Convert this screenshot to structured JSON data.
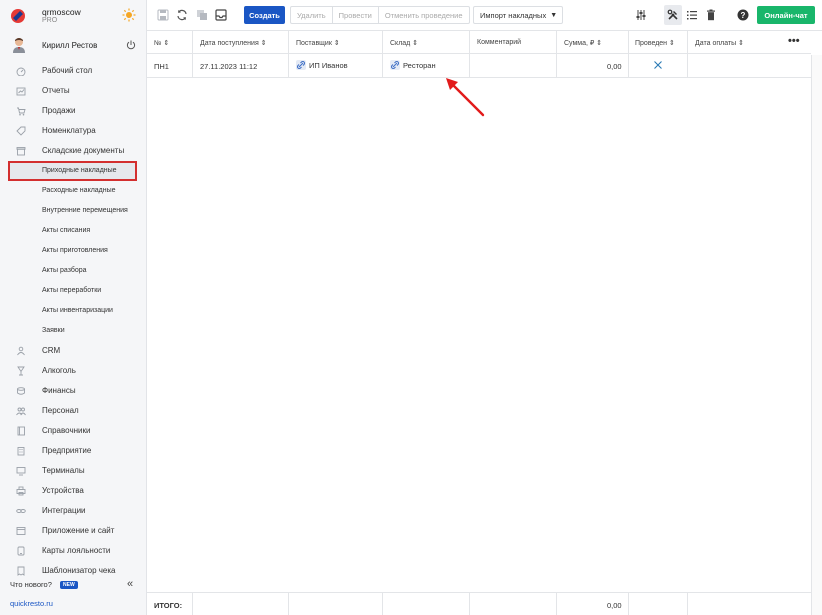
{
  "brand": {
    "name": "qrmoscow",
    "plan": "PRO"
  },
  "user": {
    "name": "Кирилл Рестов"
  },
  "sidebar": {
    "items": [
      {
        "label": "Рабочий стол",
        "icon": "gauge-icon"
      },
      {
        "label": "Отчеты",
        "icon": "report-icon"
      },
      {
        "label": "Продажи",
        "icon": "cart-icon"
      },
      {
        "label": "Номенклатура",
        "icon": "tag-icon"
      },
      {
        "label": "Складские документы",
        "icon": "box-icon"
      }
    ],
    "subitems": [
      {
        "label": "Приходные накладные",
        "active": true
      },
      {
        "label": "Расходные накладные"
      },
      {
        "label": "Внутренние перемещения"
      },
      {
        "label": "Акты списания"
      },
      {
        "label": "Акты приготовления"
      },
      {
        "label": "Акты разбора"
      },
      {
        "label": "Акты переработки"
      },
      {
        "label": "Акты инвентаризации"
      },
      {
        "label": "Заявки"
      }
    ],
    "items2": [
      {
        "label": "CRM",
        "icon": "person-icon"
      },
      {
        "label": "Алкоголь",
        "icon": "glass-icon"
      },
      {
        "label": "Финансы",
        "icon": "coins-icon"
      },
      {
        "label": "Персонал",
        "icon": "people-icon"
      },
      {
        "label": "Справочники",
        "icon": "book-icon"
      },
      {
        "label": "Предприятие",
        "icon": "building-icon"
      },
      {
        "label": "Терминалы",
        "icon": "terminal-icon"
      },
      {
        "label": "Устройства",
        "icon": "printer-icon"
      },
      {
        "label": "Интеграции",
        "icon": "link-icon"
      },
      {
        "label": "Приложение и сайт",
        "icon": "app-icon"
      },
      {
        "label": "Карты лояльности",
        "icon": "card-icon"
      },
      {
        "label": "Шаблонизатор чека",
        "icon": "receipt-icon"
      }
    ],
    "whats_new": "Что нового?",
    "new_badge": "NEW",
    "collapse": "«",
    "site": "quickresto.ru"
  },
  "toolbar": {
    "create": "Создать",
    "delete": "Удалить",
    "post": "Провести",
    "unpost": "Отменить проведение",
    "import": "Импорт накладных",
    "online_chat": "Онлайн-чат"
  },
  "table": {
    "headers": [
      "№",
      "Дата поступления",
      "Поставщик",
      "Склад",
      "Комментарий",
      "Сумма, ₽",
      "Проведен",
      "Дата оплаты"
    ],
    "rows": [
      {
        "num": "ПН1",
        "date": "27.11.2023 11:12",
        "supplier": "ИП Иванов",
        "warehouse": "Ресторан",
        "comment": "",
        "sum": "0,00",
        "posted": false,
        "paid": ""
      }
    ],
    "footer": {
      "label": "ИТОГО:",
      "sum": "0,00"
    }
  },
  "colors": {
    "accent": "#1a56c4",
    "chat": "#19b66b",
    "highlight": "#d32f2f"
  }
}
